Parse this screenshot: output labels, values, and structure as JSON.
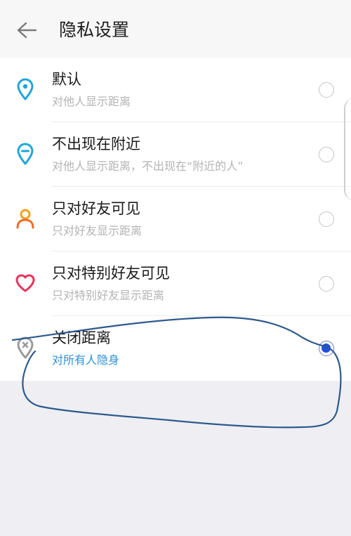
{
  "header": {
    "title": "隐私设置",
    "back_icon": "arrow-left-icon"
  },
  "options": [
    {
      "label": "默认",
      "sublabel": "对他人显示距离",
      "icon": "location-pin-dot-icon",
      "icon_color": "#1fa6d8",
      "selected": false
    },
    {
      "label": "不出现在附近",
      "sublabel": "对他人显示距离，不出现在“附近的人”",
      "icon": "location-pin-minus-icon",
      "icon_color": "#1fa6d8",
      "selected": false
    },
    {
      "label": "只对好友可见",
      "sublabel": "只对好友显示距离",
      "icon": "person-icon",
      "icon_color": "#f2a11f",
      "selected": false
    },
    {
      "label": "只对特别好友可见",
      "sublabel": "只对特别好友显示距离",
      "icon": "heart-icon",
      "icon_color": "#e8345d",
      "selected": false
    },
    {
      "label": "关闭距离",
      "sublabel": "对所有人隐身",
      "icon": "location-pin-off-icon",
      "icon_color": "#9a9a9a",
      "selected": true
    }
  ],
  "colors": {
    "selected_sublabel": "#2a8fd6",
    "radio_selected": "#1f4fe0",
    "annotation_stroke": "#2d5a8c"
  }
}
